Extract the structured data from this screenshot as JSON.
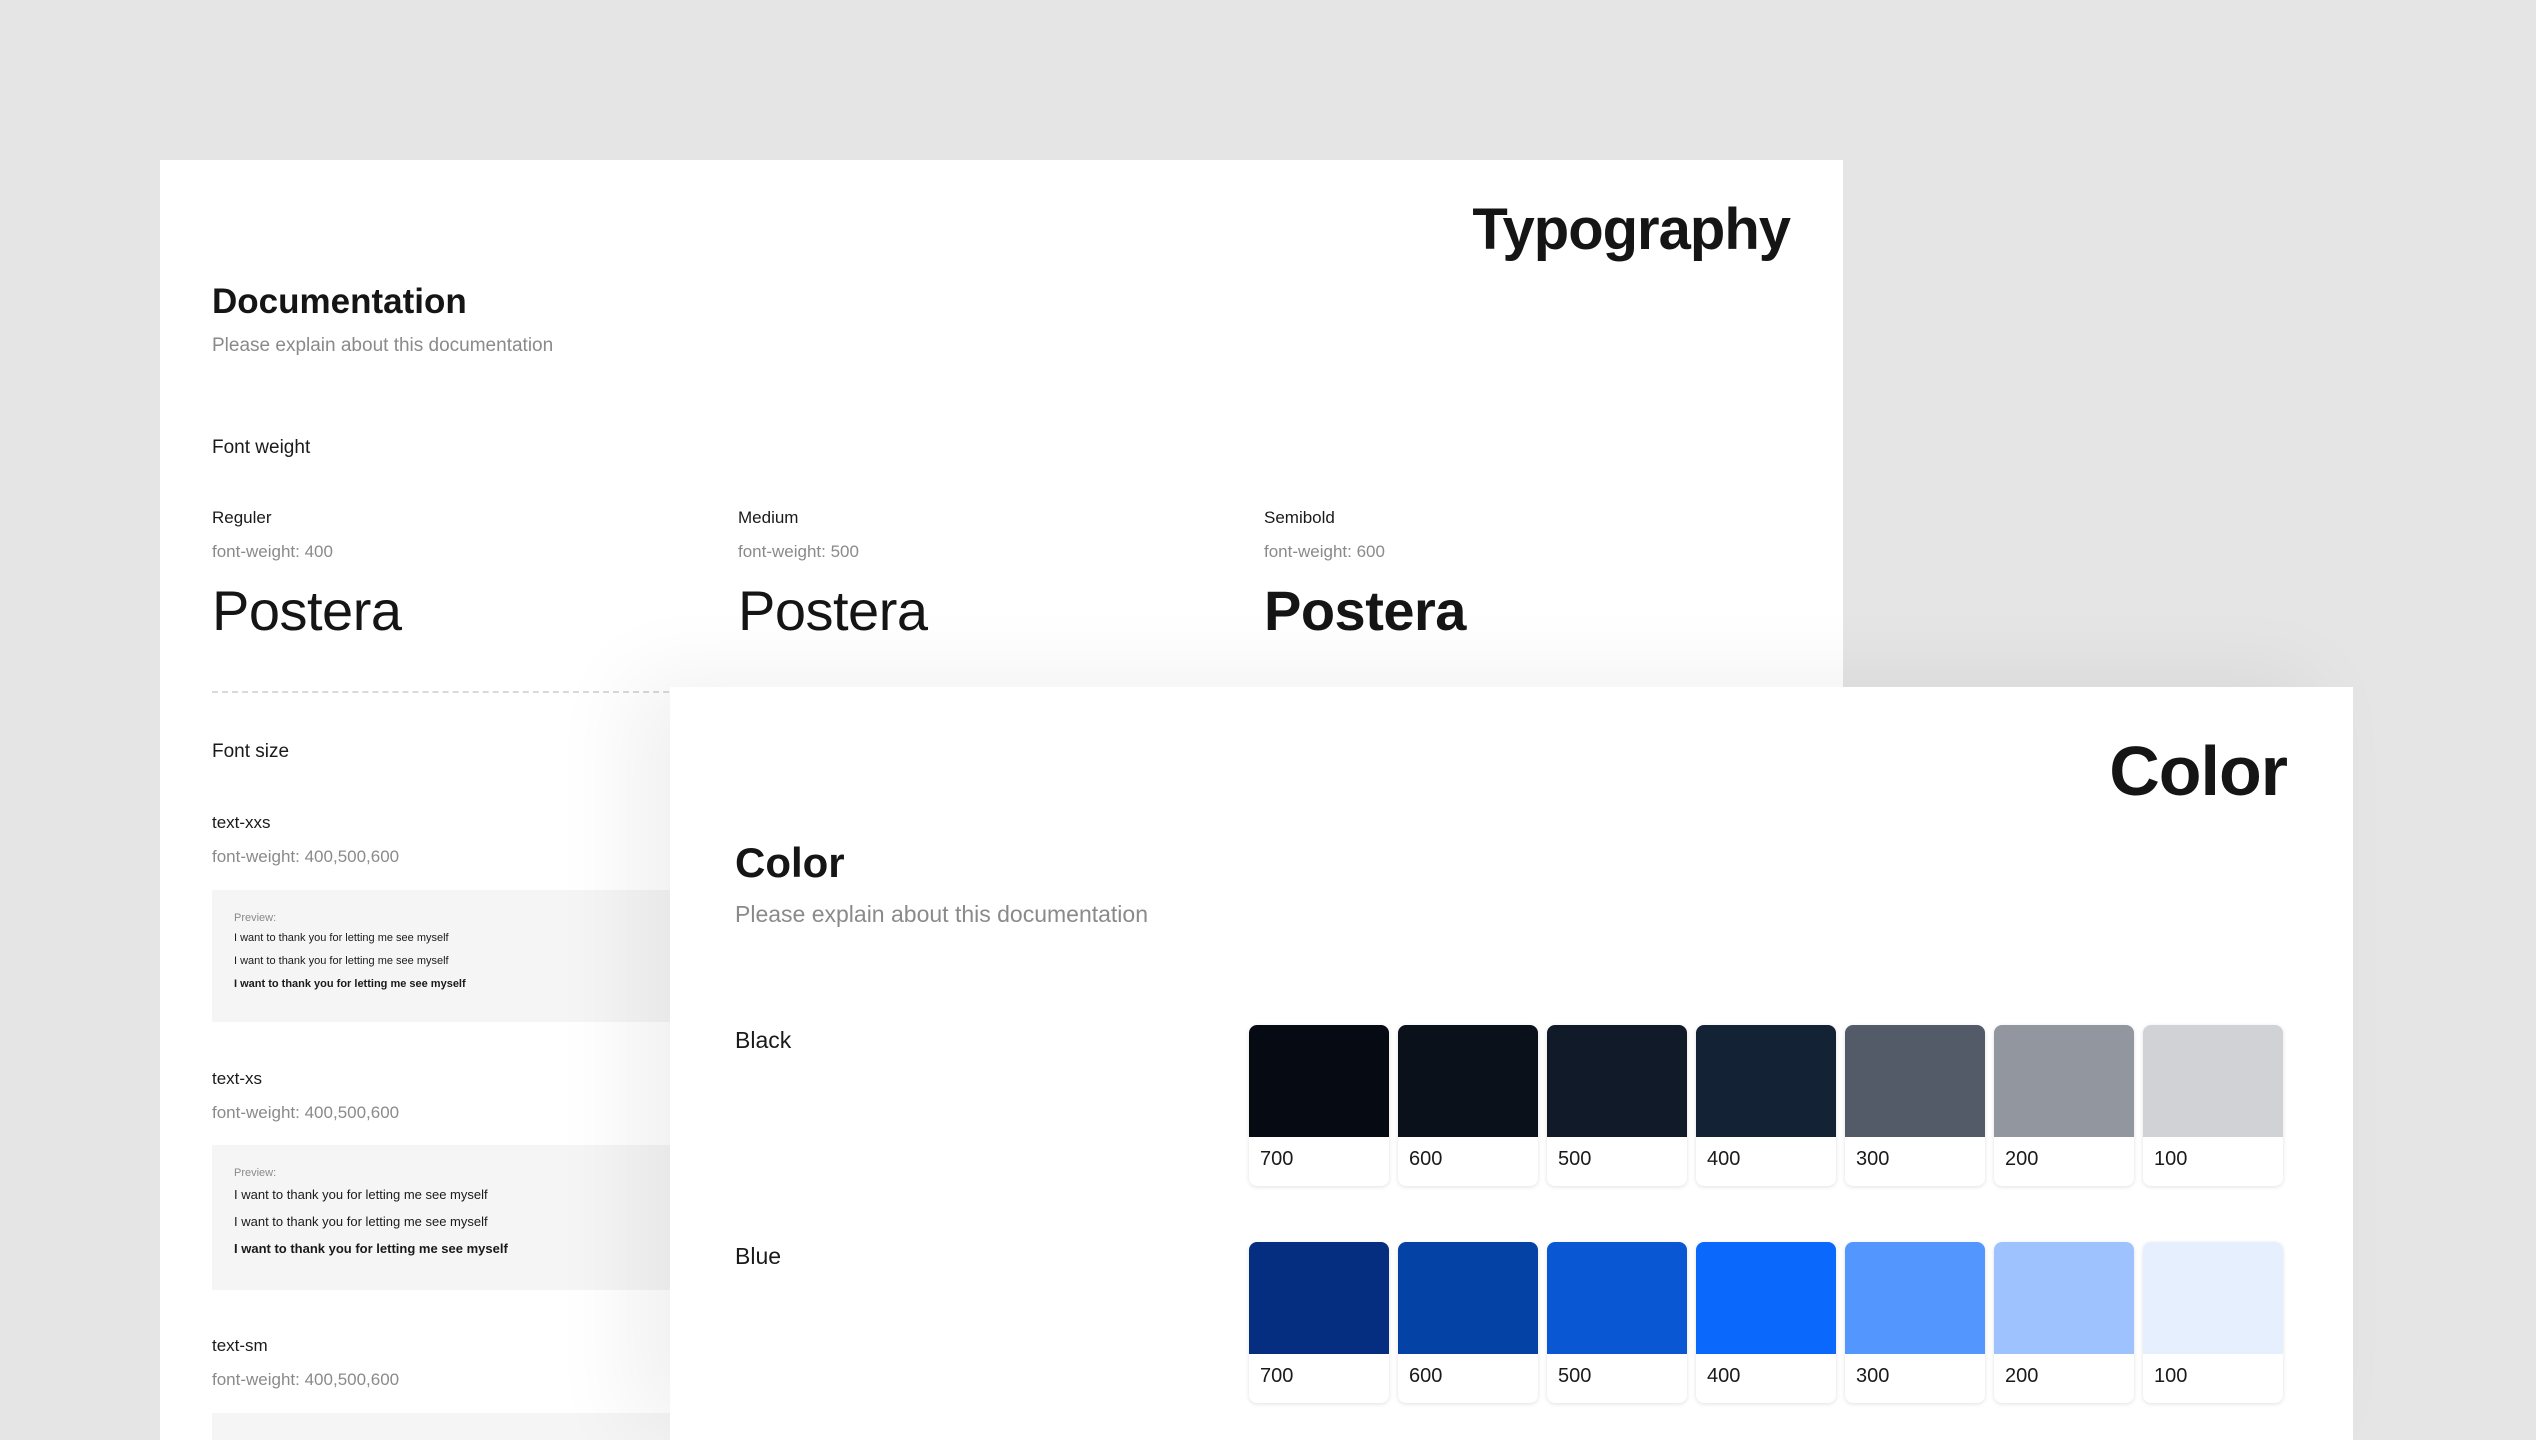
{
  "typography": {
    "title": "Typography",
    "doc_title": "Documentation",
    "doc_subtitle": "Please explain about this documentation",
    "font_weight_label": "Font weight",
    "weights": [
      {
        "name": "Reguler",
        "desc": "font-weight: 400",
        "sample": "Postera"
      },
      {
        "name": "Medium",
        "desc": "font-weight: 500",
        "sample": "Postera"
      },
      {
        "name": "Semibold",
        "desc": "font-weight: 600",
        "sample": "Postera"
      }
    ],
    "font_size_label": "Font size",
    "sizes": [
      {
        "name": "text-xxs",
        "desc": "font-weight: 400,500,600",
        "preview_label": "Preview:",
        "lines": [
          "I want to thank you for letting me see myself",
          "I want to thank you for letting me see myself",
          "I want to thank you for letting me see myself"
        ]
      },
      {
        "name": "text-xs",
        "desc": "font-weight: 400,500,600",
        "preview_label": "Preview:",
        "lines": [
          "I want to thank you for letting me see myself",
          "I want to thank you for letting me see myself",
          "I want to thank you for letting me see myself"
        ]
      },
      {
        "name": "text-sm",
        "desc": "font-weight: 400,500,600"
      }
    ]
  },
  "color": {
    "title": "Color",
    "doc_title": "Color",
    "doc_subtitle": "Please explain about this documentation",
    "groups": [
      {
        "label": "Black",
        "swatches": [
          {
            "shade": "700",
            "hex": "#060a12"
          },
          {
            "shade": "600",
            "hex": "#0b111b"
          },
          {
            "shade": "500",
            "hex": "#111a29"
          },
          {
            "shade": "400",
            "hex": "#142235"
          },
          {
            "shade": "300",
            "hex": "#535b69"
          },
          {
            "shade": "200",
            "hex": "#92969f"
          },
          {
            "shade": "100",
            "hex": "#d0d2d6"
          }
        ]
      },
      {
        "label": "Blue",
        "swatches": [
          {
            "shade": "700",
            "hex": "#062e80"
          },
          {
            "shade": "600",
            "hex": "#0442a6"
          },
          {
            "shade": "500",
            "hex": "#0957d3"
          },
          {
            "shade": "400",
            "hex": "#0b68fd"
          },
          {
            "shade": "300",
            "hex": "#5396fd"
          },
          {
            "shade": "200",
            "hex": "#9dc2fd"
          },
          {
            "shade": "100",
            "hex": "#e6effe"
          }
        ]
      }
    ]
  }
}
